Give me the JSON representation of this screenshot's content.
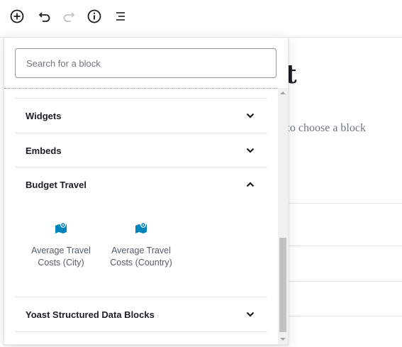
{
  "toolbar": {
    "add_block": "add-block",
    "undo": "undo",
    "redo": "redo",
    "info": "content-structure",
    "outline": "block-navigation"
  },
  "background": {
    "title_fragment": "t",
    "hint_text": "/ to choose a block"
  },
  "inserter": {
    "search_placeholder": "Search for a block",
    "panels": [
      {
        "label": "Widgets",
        "state": "collapsed"
      },
      {
        "label": "Embeds",
        "state": "collapsed"
      },
      {
        "label": "Budget Travel",
        "state": "expanded"
      },
      {
        "label": "Yoast Structured Data Blocks",
        "state": "collapsed"
      }
    ],
    "budget_travel_blocks": [
      {
        "label": "Average Travel Costs (City)",
        "icon": "map-pin-icon"
      },
      {
        "label": "Average Travel Costs (Country)",
        "icon": "map-pin-icon"
      }
    ]
  },
  "colors": {
    "accent_blue": "#0085ba",
    "border": "#e2e4e7",
    "text": "#191e23"
  }
}
